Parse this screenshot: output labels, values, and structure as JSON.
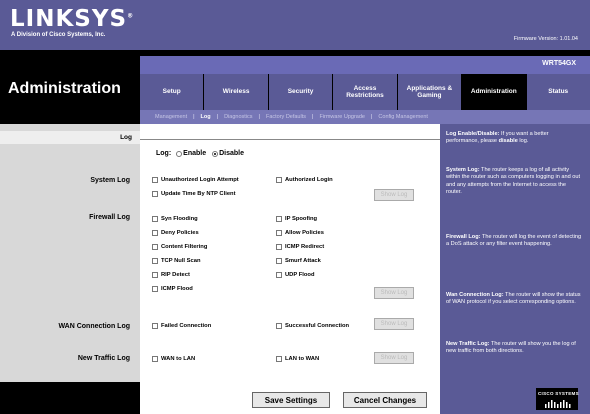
{
  "brand": {
    "logo": "LINKSYS",
    "logo_mark": "®",
    "sub": "A Division of Cisco Systems, Inc."
  },
  "firmware": "Firmware Version: 1.01.04",
  "model": "WRT54GX",
  "section_title": "Administration",
  "tabs": [
    {
      "label": "Setup",
      "active": false
    },
    {
      "label": "Wireless",
      "active": false
    },
    {
      "label": "Security",
      "active": false
    },
    {
      "label": "Access Restrictions",
      "active": false
    },
    {
      "label": "Applications & Gaming",
      "active": false
    },
    {
      "label": "Administration",
      "active": true
    },
    {
      "label": "Status",
      "active": false
    }
  ],
  "subtabs": [
    {
      "label": "Management",
      "active": false
    },
    {
      "label": "Log",
      "active": true
    },
    {
      "label": "Diagnostics",
      "active": false
    },
    {
      "label": "Factory Defaults",
      "active": false
    },
    {
      "label": "Firmware Upgrade",
      "active": false
    },
    {
      "label": "Config Management",
      "active": false
    }
  ],
  "log": {
    "section_label": "Log",
    "log_label": "Log:",
    "enable": "Enable",
    "disable": "Disable",
    "selected": "Disable"
  },
  "system_log": {
    "label": "System Log",
    "options": [
      "Unauthorized Login Attempt",
      "Authorized Login",
      "Update Time By NTP Client"
    ],
    "show_log": "Show Log"
  },
  "firewall_log": {
    "label": "Firewall Log",
    "left": [
      "Syn Flooding",
      "Deny Policies",
      "Content Filtering",
      "TCP Null Scan",
      "RIP Detect",
      "ICMP Flood"
    ],
    "right": [
      "IP Spoofing",
      "Allow Policies",
      "ICMP Redirect",
      "Smurf Attack",
      "UDP Flood"
    ],
    "show_log": "Show Log"
  },
  "wan_log": {
    "label": "WAN Connection Log",
    "options": [
      "Failed Connection",
      "Successful Connection"
    ],
    "show_log": "Show Log"
  },
  "traffic_log": {
    "label": "New Traffic Log",
    "options": [
      "WAN to LAN",
      "LAN to WAN"
    ],
    "show_log": "Show Log"
  },
  "buttons": {
    "save": "Save Settings",
    "cancel": "Cancel Changes"
  },
  "help": {
    "p1_title": "Log Enable/Disable:",
    "p1_a": "If you want a better performance, please ",
    "p1_b": "disable",
    "p1_c": " log.",
    "p2_title": "System Log:",
    "p2": "The router keeps a log of all activity within the router such as computers logging in and out and any attempts from the Internet to access the router.",
    "p3_title": "Firewall Log:",
    "p3": "The router will log the event of detecting a DoS attack or any filter event happening.",
    "p4_title": "Wan Connection Log:",
    "p4": "The router will show the status of WAN protocol if you select corresponding options.",
    "p5_title": "New Traffic Log:",
    "p5": "The router will show you the log of new traffic from both directions."
  },
  "cisco": "CISCO SYSTEMS",
  "colors": {
    "brand_blue": "#5a5a96",
    "nav_black": "#000000",
    "sub_blue": "#7676b6",
    "panel_gray": "#d8d8d8"
  }
}
